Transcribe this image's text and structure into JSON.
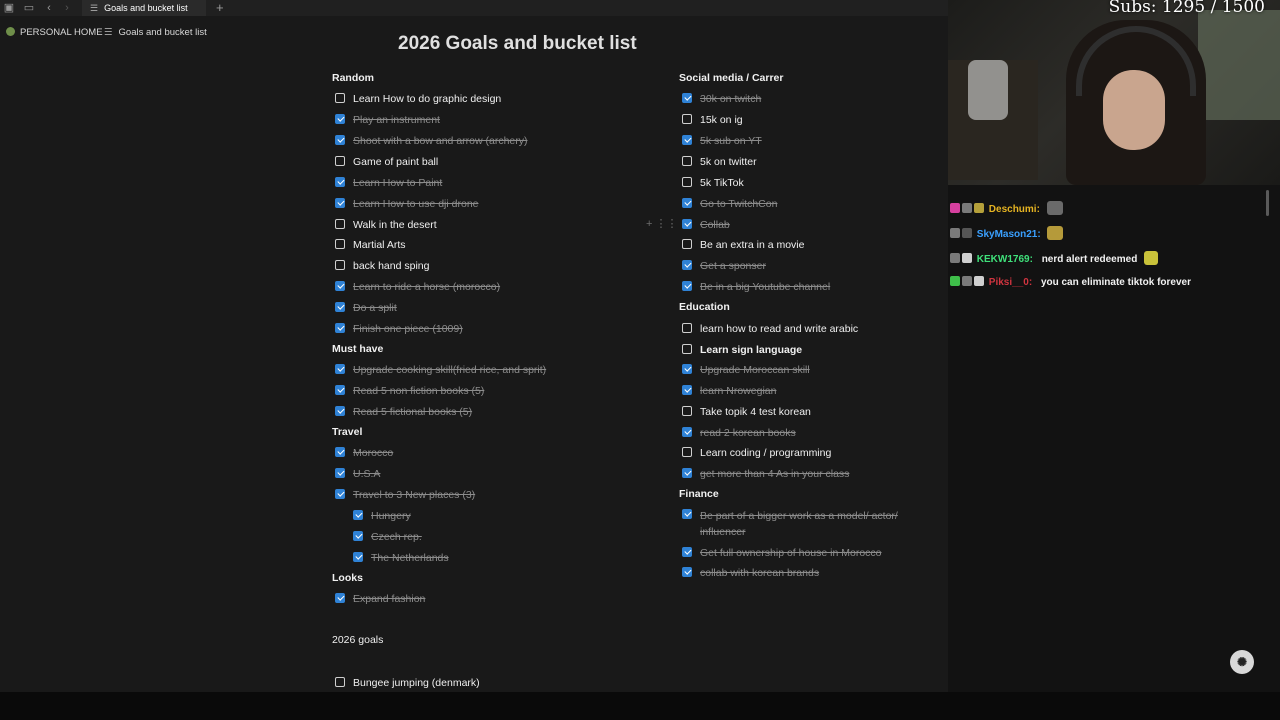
{
  "browser": {
    "tab_title": "Goals and bucket list",
    "new_tab_glyph": "+"
  },
  "breadcrumb": {
    "home": "PERSONAL HOME",
    "page": "Goals and bucket list"
  },
  "page": {
    "title": "2026 Goals and bucket list"
  },
  "left_column": {
    "sections": [
      {
        "heading": "Random",
        "items": [
          {
            "label": "Learn How to do graphic design",
            "checked": false
          },
          {
            "label": "Play an instrument",
            "checked": true
          },
          {
            "label": "Shoot with a bow and arrow (archery)",
            "checked": true
          },
          {
            "label": "Game of paint ball",
            "checked": false
          },
          {
            "label": "Learn How to Paint",
            "checked": true
          },
          {
            "label": "Learn How to use dji drone",
            "checked": true
          },
          {
            "label": "Walk in the desert",
            "checked": false
          },
          {
            "label": "Martial Arts",
            "checked": false
          },
          {
            "label": "back hand sping",
            "checked": false
          },
          {
            "label": "Learn to ride a horse (morocco)",
            "checked": true
          },
          {
            "label": "Do a split",
            "checked": true
          },
          {
            "label": "Finish one piece (1009)",
            "checked": true
          }
        ]
      },
      {
        "heading": "Must have",
        "items": [
          {
            "label": "Upgrade cooking skill(fried rice, and sprit)",
            "checked": true
          },
          {
            "label": "Read 5 non fiction books (5)",
            "checked": true
          },
          {
            "label": "Read 5 fictional books (5)",
            "checked": true
          }
        ]
      },
      {
        "heading": "Travel",
        "items": [
          {
            "label": "Morocco",
            "checked": true
          },
          {
            "label": "U.S.A",
            "checked": true
          },
          {
            "label": "Travel to 3 New places (3)",
            "checked": true
          },
          {
            "label": "Hungery",
            "checked": true,
            "indent": true
          },
          {
            "label": "Czech rep.",
            "checked": true,
            "indent": true
          },
          {
            "label": "The Netherlands",
            "checked": true,
            "indent": true
          }
        ]
      },
      {
        "heading": "Looks",
        "items": [
          {
            "label": "Expand fashion",
            "checked": true
          }
        ]
      }
    ],
    "goals_2026_label": "2026 goals",
    "goals_2026_items": [
      {
        "label": "Bungee jumping  (denmark)",
        "checked": false
      }
    ]
  },
  "right_column": {
    "sections": [
      {
        "heading": "Social media / Carrer",
        "items": [
          {
            "label": "30k on twitch",
            "checked": true
          },
          {
            "label": "15k on ig",
            "checked": false
          },
          {
            "label": "5k sub on YT",
            "checked": true
          },
          {
            "label": "5k on twitter",
            "checked": false
          },
          {
            "label": "5k TikTok",
            "checked": false
          },
          {
            "label": "Go to TwitchCon",
            "checked": true
          },
          {
            "label": "Collab",
            "checked": true
          },
          {
            "label": "Be an extra in a movie",
            "checked": false
          },
          {
            "label": "Get a sponser",
            "checked": true
          },
          {
            "label": "Be in a big Youtube channel",
            "checked": true
          }
        ]
      },
      {
        "heading": "Education",
        "items": [
          {
            "label": "learn how to read and write arabic",
            "checked": false
          },
          {
            "label": "Learn sign language",
            "checked": false
          },
          {
            "label": "Upgrade Moroccan skill",
            "checked": true
          },
          {
            "label": "learn Nrowegian",
            "checked": true
          },
          {
            "label": "Take topik 4 test korean",
            "checked": false
          },
          {
            "label": "read 2 korean books",
            "checked": true
          },
          {
            "label": "Learn coding / programming",
            "checked": false
          },
          {
            "label": "get more than 4 As in your class",
            "checked": true
          }
        ]
      },
      {
        "heading": "Finance",
        "items": [
          {
            "label": "Be part of a bigger work as a model/ actor/ influencer",
            "checked": true,
            "wrap": true
          },
          {
            "label": "Get full ownership of house in Morocco",
            "checked": true
          },
          {
            "label": "collab with korean brands",
            "checked": true
          }
        ]
      }
    ]
  },
  "stream": {
    "subs_text": "Subs: 1295 / 1500",
    "chat": [
      {
        "user": "Deschumi:",
        "color": "#e6b422",
        "message": ""
      },
      {
        "user": "SkyMason21:",
        "color": "#3aa0ff",
        "message": ""
      },
      {
        "user": "KEKW1769:",
        "color": "#3fe07a",
        "message": "nerd alert redeemed"
      },
      {
        "user": "Piksi__0:",
        "color": "#d0343f",
        "message": "you can eliminate tiktok forever"
      }
    ]
  },
  "icons": {
    "drag_handle": "drag-handle-icon",
    "add_block": "plus-icon"
  }
}
